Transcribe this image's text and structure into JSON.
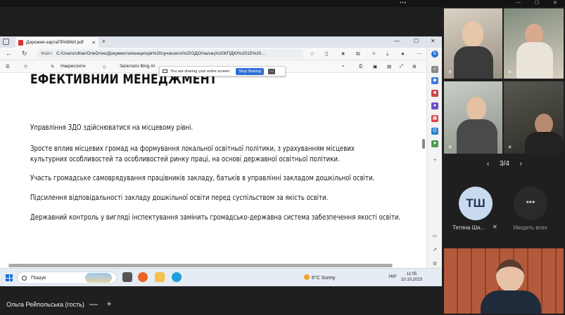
{
  "browser": {
    "tab_title": "Дорожня картаПРАВКИ.pdf",
    "address_label": "Файл",
    "url": "C:/Users/olhar/OneDrive/Документи/концепція%20сучасного%20ЗДО/палац%20КПДЮ%2015%20..."
  },
  "pdf_toolbar": {
    "draw_label": "Накреслити",
    "ask_label": "Запитати Bing AI"
  },
  "share_banner": {
    "message": "You are sharing your entire screen.",
    "stop_label": "Stop Sharing"
  },
  "document": {
    "heading": "ЕФЕКТИВНИЙ МЕНЕДЖМЕНТ",
    "paragraphs": [
      "Управління ЗДО здійснюватися на місцевому рівні.",
      "Зросте вплив місцевих громад на формування локальної освітньої політики, з урахуванням місцевих культурних особливостей та особливостей ринку праці, на основі державної освітньої політики.",
      "Участь громадське самоврядування працівників закладу, батьків в управлінні закладом дошкільної освіти.",
      "Підсилення відповідальності закладу дошкільної освіти перед суспільством за якість освіти.",
      "Державний контроль у вигляді інспектування замінить громадсько-державна система забезпечення якості освіти."
    ]
  },
  "taskbar": {
    "search_label": "Пошук",
    "weather": "6°C  Sunny",
    "language": "УКР",
    "time": "11:05",
    "date": "10.10.2023"
  },
  "participants": {
    "pager": "3/4",
    "avatar_initials": "ТШ",
    "avatar_name": "Тетяна Ша...",
    "more_icon": "•••",
    "see_all": "Увидеть всех"
  },
  "meeting": {
    "self_name": "Ольга Рейпольська (гость)"
  },
  "colors": {
    "accent": "#2f6fd6",
    "meeting_bg": "#1f1f1f",
    "avatar_bg": "#c9d9ef"
  }
}
